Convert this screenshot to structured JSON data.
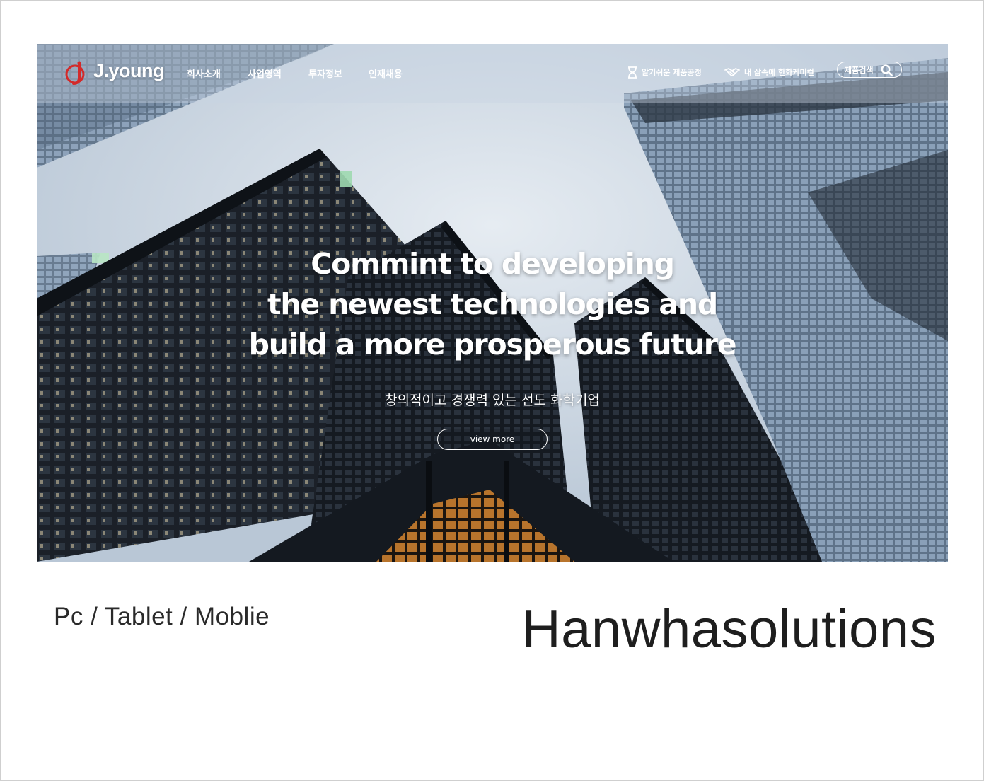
{
  "header": {
    "logo_text": "J.young",
    "nav": [
      "회사소개",
      "사업영역",
      "투자정보",
      "인재채용"
    ],
    "util_links": [
      {
        "label": "알기쉬운 제품공정",
        "icon": "hourglass-icon"
      },
      {
        "label": "내 삶속에 한화케미컬",
        "icon": "handshake-icon"
      }
    ],
    "search_label": "제품검색",
    "search_icon": "search-icon"
  },
  "hero": {
    "title_lines": [
      "Commint to developing",
      "the newest technologies and",
      "build a more prosperous future"
    ],
    "subtitle": "창의적이고 경쟁력 있는 선도 화학기업",
    "button_label": "view more"
  },
  "caption": {
    "devices": "Pc / Tablet / Moblie",
    "project": "Hanwhasolutions"
  },
  "colors": {
    "brand_red": "#d32a2a",
    "header_text": "#ffffff",
    "caption_text": "#1e1e1e"
  }
}
